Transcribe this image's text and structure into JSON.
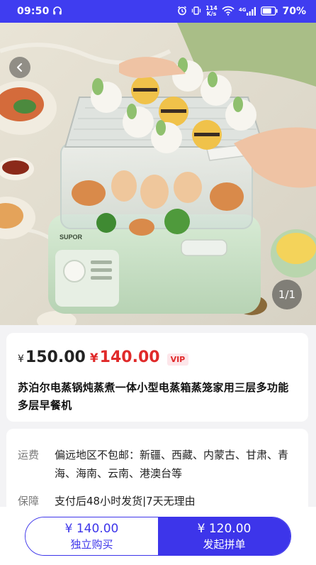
{
  "status_bar": {
    "time": "09:50",
    "net_speed_value": "114",
    "net_speed_unit": "K/s",
    "network_type": "4G",
    "battery": "70%",
    "icons": [
      "headphones-icon",
      "alarm-icon",
      "vibrate-icon",
      "wifi-icon",
      "signal-icon",
      "battery-icon"
    ],
    "bg_color": "#3f3df0"
  },
  "gallery": {
    "back_icon": "chevron-left-icon",
    "indicator": "1/1"
  },
  "price": {
    "original_symbol": "¥",
    "original": "150.00",
    "vip_symbol": "¥",
    "vip": "140.00",
    "vip_badge": "VIP",
    "accent_color": "#e02a2a"
  },
  "product": {
    "title": "苏泊尔电蒸锅炖蒸煮一体小型电蒸箱蒸笼家用三层多功能多层早餐机"
  },
  "info": {
    "shipping_label": "运费",
    "shipping_value": "偏远地区不包邮：新疆、西藏、内蒙古、甘肃、青海、海南、云南、港澳台等",
    "guarantee_label": "保障",
    "guarantee_value": "支付后48小时发货|7天无理由"
  },
  "actions": {
    "solo_price": "¥ 140.00",
    "solo_label": "独立购买",
    "group_price": "¥ 120.00",
    "group_label": "发起拼单",
    "brand_color": "#3d35ea"
  }
}
